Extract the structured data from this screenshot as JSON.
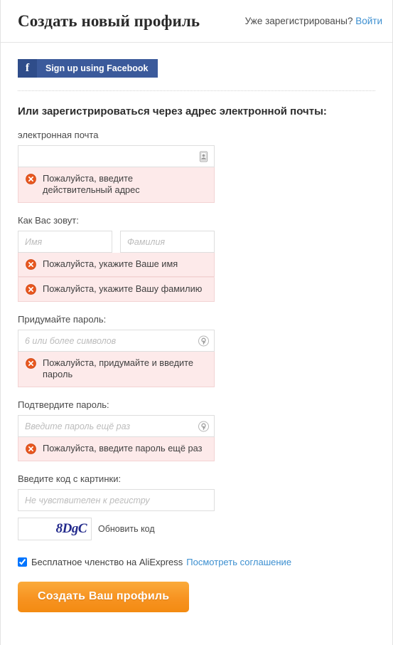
{
  "header": {
    "title": "Создать новый профиль",
    "login_prompt": "Уже зарегистрированы?",
    "login_link": "Войти"
  },
  "social": {
    "facebook_label": "Sign up using Facebook",
    "facebook_icon_letter": "f",
    "facebook_bg": "#3b5a9b",
    "facebook_icon_bg": "#2f4d8a"
  },
  "form": {
    "section_heading": "Или зарегистрироваться через адрес электронной почты:",
    "email": {
      "label": "электронная почта",
      "value": "",
      "placeholder": "",
      "error": "Пожалуйста, введите действительный адрес"
    },
    "name": {
      "label": "Как Вас зовут:",
      "first_placeholder": "Имя",
      "first_value": "",
      "last_placeholder": "Фамилия",
      "last_value": "",
      "first_error": "Пожалуйста, укажите Ваше имя",
      "last_error": "Пожалуйста, укажите Вашу фамилию"
    },
    "password": {
      "label": "Придумайте пароль:",
      "placeholder": "6 или более символов",
      "value": "",
      "error": "Пожалуйста, придумайте и введите пароль"
    },
    "confirm_password": {
      "label": "Подтвердите пароль:",
      "placeholder": "Введите пароль ещё раз",
      "value": "",
      "error": "Пожалуйста, введите пароль ещё раз"
    },
    "captcha": {
      "label": "Введите код с картинки:",
      "placeholder": "Не чувствителен к регистру",
      "value": "",
      "code_text": "8DgC",
      "code_color": "#232a8c",
      "refresh_label": "Обновить код"
    },
    "agreement": {
      "checked": true,
      "text": "Бесплатное членство на AliExpress",
      "link": "Посмотреть соглашение"
    },
    "submit_label": "Создать Ваш профиль"
  },
  "colors": {
    "link": "#3c8fd0",
    "error_bg": "#fdeaea",
    "error_border": "#f3d3d3",
    "error_icon": "#e8571f",
    "accent": "#f79321"
  },
  "icons": {
    "email_field": "contact-card-icon",
    "password_field": "lock-icon",
    "error": "error-circle-icon"
  }
}
